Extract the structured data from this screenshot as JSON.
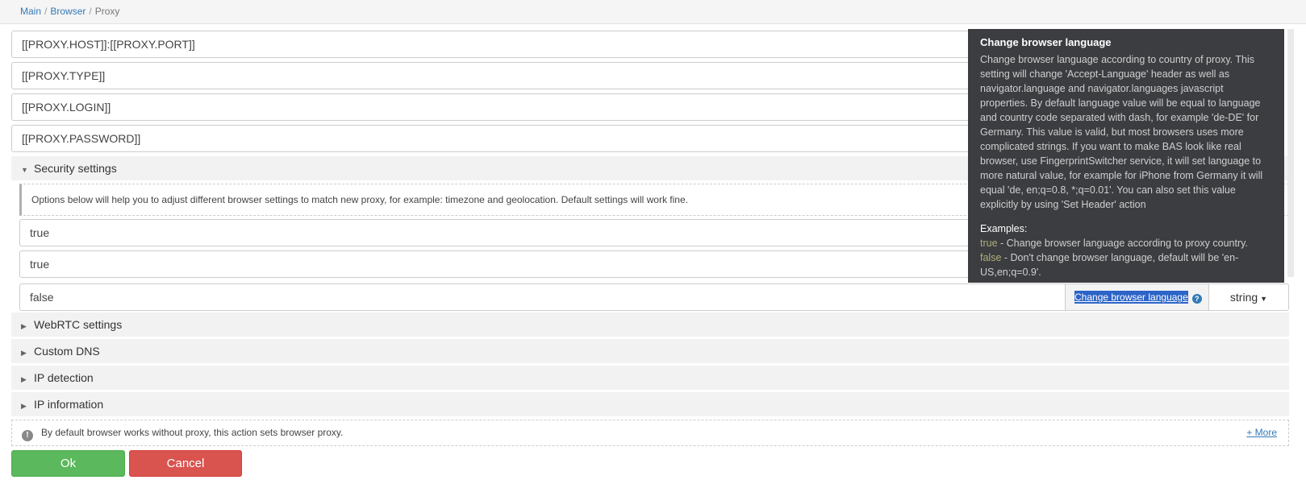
{
  "breadcrumb": {
    "main": "Main",
    "browser": "Browser",
    "current": "Proxy"
  },
  "fields": {
    "proxy_host_port": "[[PROXY.HOST]]:[[PROXY.PORT]]",
    "proxy_type": "[[PROXY.TYPE]]",
    "proxy_login": "[[PROXY.LOGIN]]",
    "proxy_password": "[[PROXY.PASSWORD]]"
  },
  "security": {
    "title": "Security settings",
    "hint": "Options below will help you to adjust different browser settings to match new proxy, for example: timezone and geolocation. Default settings will work fine.",
    "values": [
      "true",
      "true",
      "false"
    ],
    "language_label": "Change browser language",
    "language_type": "string"
  },
  "tooltip": {
    "title": "Change browser language",
    "body": "Change browser language according to country of proxy. This setting will change 'Accept-Language' header as well as navigator.language and navigator.languages javascript properties. By default language value will be equal to language and country code separated with dash, for example 'de-DE' for Germany. This value is valid, but most browsers uses more complicated strings. If you want to make BAS look like real browser, use FingerprintSwitcher service, it will set language to more natural value, for example for iPhone from Germany it will equal 'de, en;q=0.8, *;q=0.01'. You can also set this value explicitly by using 'Set Header' action",
    "examples_title": "Examples:",
    "ex1_key": "true",
    "ex1_text": " - Change browser language according to proxy country.",
    "ex2_key": "false",
    "ex2_text": " - Don't change browser language, default will be 'en-US,en;q=0.9'."
  },
  "sections": [
    "WebRTC settings",
    "Custom DNS",
    "IP detection",
    "IP information"
  ],
  "info": {
    "text": "By default browser works without proxy, this action sets browser proxy.",
    "more": "+ More"
  },
  "buttons": {
    "ok": "Ok",
    "cancel": "Cancel"
  }
}
